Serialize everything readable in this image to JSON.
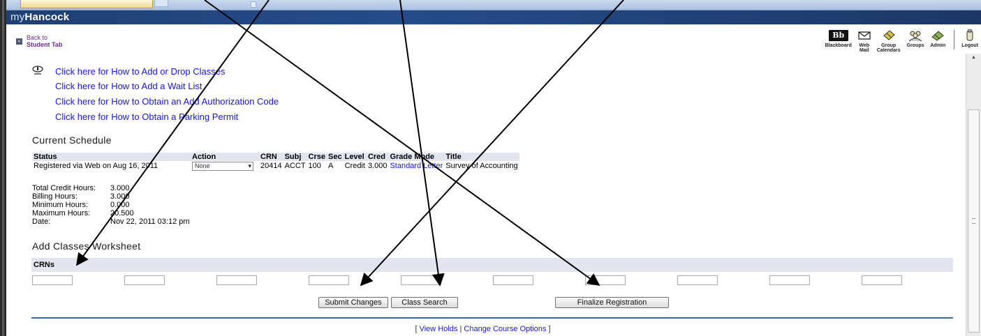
{
  "app": {
    "brand_prefix": "my",
    "brand_name": "Hancock"
  },
  "toolbar": {
    "back_line1": "Back to",
    "back_line2": "Student Tab",
    "tools": [
      {
        "icon": "blackboard-icon",
        "label1": "Blackboard",
        "label2": ""
      },
      {
        "icon": "mail-icon",
        "label1": "Web",
        "label2": "Mail"
      },
      {
        "icon": "calendar-icon",
        "label1": "Group",
        "label2": "Calendars"
      },
      {
        "icon": "groups-icon",
        "label1": "Groups",
        "label2": ""
      },
      {
        "icon": "admin-icon",
        "label1": "Admin",
        "label2": ""
      },
      {
        "icon": "logout-icon",
        "label1": "Logout",
        "label2": ""
      }
    ],
    "bb_text": "Bb"
  },
  "links": [
    "Click here for How to Add or Drop Classes",
    "Click here for How to Add a Wait List",
    "Click here for How to Obtain an Add Authorization Code",
    "Click here for How to Obtain a Parking Permit"
  ],
  "current_schedule": {
    "title": "Current Schedule",
    "headers": [
      "Status",
      "Action",
      "CRN",
      "Subj",
      "Crse",
      "Sec",
      "Level",
      "Cred",
      "Grade Mode",
      "Title"
    ],
    "row": {
      "status": "Registered via Web on Aug 16, 2011",
      "action": "None",
      "crn": "20414",
      "subj": "ACCT",
      "crse": "100",
      "sec": "A",
      "level": "Credit",
      "cred": "3.000",
      "grade_mode": "Standard Letter",
      "title": "Survey of Accounting"
    }
  },
  "hours": {
    "total_label": "Total Credit Hours:",
    "total_value": "3.000",
    "billing_label": "Billing Hours:",
    "billing_value": "3.000",
    "min_label": "Minimum Hours:",
    "min_value": "0.000",
    "max_label": "Maximum Hours:",
    "max_value": "20.500",
    "date_label": "Date:",
    "date_value": "Nov 22, 2011 03:12 pm"
  },
  "worksheet": {
    "title": "Add Classes Worksheet",
    "crn_header": "CRNs",
    "crn_values": [
      "",
      "",
      "",
      "",
      "",
      "",
      "",
      "",
      "",
      ""
    ]
  },
  "buttons": {
    "submit": "Submit Changes",
    "search": "Class Search",
    "finalize": "Finalize Registration"
  },
  "footer": {
    "open": "[",
    "view_holds": "View Holds",
    "divider": "|",
    "change_options": "Change Course Options",
    "close": "]"
  }
}
